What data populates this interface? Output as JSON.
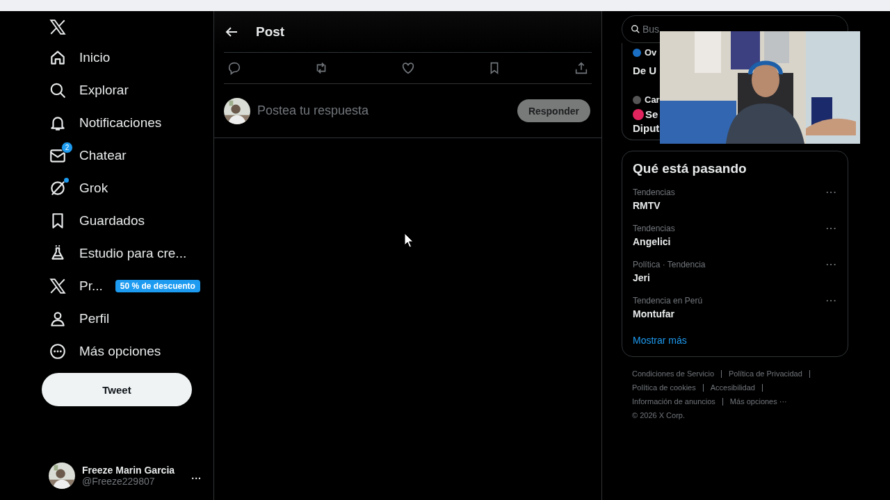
{
  "nav": {
    "items": [
      {
        "kind": "home",
        "label": "Inicio"
      },
      {
        "kind": "search",
        "label": "Explorar"
      },
      {
        "kind": "bell",
        "label": "Notificaciones"
      },
      {
        "kind": "mail",
        "label": "Chatear",
        "badge": "2"
      },
      {
        "kind": "grok",
        "label": "Grok",
        "dot": true
      },
      {
        "kind": "bookmark",
        "label": "Guardados"
      },
      {
        "kind": "flask",
        "label": "Estudio para cre..."
      },
      {
        "kind": "x",
        "label": "Pr...",
        "promo": "50 % de descuento"
      },
      {
        "kind": "person",
        "label": "Perfil"
      },
      {
        "kind": "more",
        "label": "Más opciones"
      }
    ],
    "post_button": "Tweet",
    "account": {
      "name": "Freeze Marin Garcia",
      "handle": "@Freeze229807",
      "menu": "..."
    }
  },
  "post": {
    "title": "Post",
    "actions": [
      {
        "kind": "reply"
      },
      {
        "kind": "repost"
      },
      {
        "kind": "like"
      },
      {
        "kind": "bookmark"
      },
      {
        "kind": "share"
      }
    ],
    "reply": {
      "placeholder": "Postea tu respuesta",
      "button": "Responder",
      "disabled": true
    }
  },
  "aside": {
    "search": {
      "placeholder": "Bus"
    },
    "covered_items": [
      {
        "source": "Ov",
        "lines": [
          "De U"
        ]
      },
      {
        "source": "Car",
        "live": true,
        "lines": [
          "Se",
          "Diput"
        ]
      }
    ],
    "trends": {
      "title": "Qué está pasando",
      "items": [
        {
          "context": "Tendencias",
          "name": "RMTV",
          "menu": "···"
        },
        {
          "context": "Tendencias",
          "name": "Angelici",
          "menu": "···"
        },
        {
          "context": "Política · Tendencia",
          "name": "Jeri",
          "menu": "···"
        },
        {
          "context": "Tendencia en Perú",
          "name": "Montufar",
          "menu": "···"
        }
      ],
      "show_more": "Mostrar más"
    },
    "footer": {
      "links": [
        [
          "Condiciones de Servicio",
          "Política de Privacidad"
        ],
        [
          "Política de cookies",
          "Accesibilidad"
        ],
        [
          "Información de anuncios",
          "Más opciones ···"
        ]
      ],
      "copyright": "© 2026 X Corp."
    }
  }
}
